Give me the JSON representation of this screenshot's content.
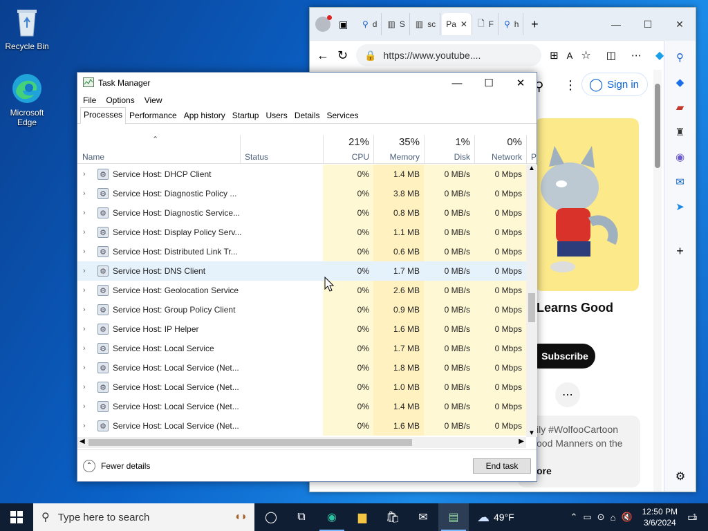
{
  "desktop": {
    "icons": [
      {
        "label": "Recycle Bin"
      },
      {
        "label": "Microsoft Edge"
      }
    ]
  },
  "edge": {
    "tabs": [
      "d",
      "S",
      "sc",
      "Pa",
      "F",
      "h"
    ],
    "address": "https://www.youtube....",
    "page": {
      "sign_in": "Sign in",
      "channel_title_fragment": "Learns Good",
      "subscribe": "Subscribe",
      "desc_line1": "ily #WolfooCartoon",
      "desc_line2": "ood Manners on the",
      "desc_line3": "ore"
    }
  },
  "taskmanager": {
    "title": "Task Manager",
    "menu": [
      "File",
      "Options",
      "View"
    ],
    "tabs": [
      "Processes",
      "Performance",
      "App history",
      "Startup",
      "Users",
      "Details",
      "Services"
    ],
    "active_tab": "Processes",
    "columns": {
      "name": "Name",
      "status": "Status",
      "cpu": {
        "label": "CPU",
        "pct": "21%"
      },
      "memory": {
        "label": "Memory",
        "pct": "35%"
      },
      "disk": {
        "label": "Disk",
        "pct": "1%"
      },
      "network": {
        "label": "Network",
        "pct": "0%"
      },
      "power": "P"
    },
    "rows": [
      {
        "name": "Service Host: DHCP Client",
        "cpu": "0%",
        "mem": "1.4 MB",
        "disk": "0 MB/s",
        "net": "0 Mbps"
      },
      {
        "name": "Service Host: Diagnostic Policy ...",
        "cpu": "0%",
        "mem": "3.8 MB",
        "disk": "0 MB/s",
        "net": "0 Mbps"
      },
      {
        "name": "Service Host: Diagnostic Service...",
        "cpu": "0%",
        "mem": "0.8 MB",
        "disk": "0 MB/s",
        "net": "0 Mbps"
      },
      {
        "name": "Service Host: Display Policy Serv...",
        "cpu": "0%",
        "mem": "1.1 MB",
        "disk": "0 MB/s",
        "net": "0 Mbps"
      },
      {
        "name": "Service Host: Distributed Link Tr...",
        "cpu": "0%",
        "mem": "0.6 MB",
        "disk": "0 MB/s",
        "net": "0 Mbps"
      },
      {
        "name": "Service Host: DNS Client",
        "cpu": "0%",
        "mem": "1.7 MB",
        "disk": "0 MB/s",
        "net": "0 Mbps",
        "selected": true
      },
      {
        "name": "Service Host: Geolocation Service",
        "cpu": "0%",
        "mem": "2.6 MB",
        "disk": "0 MB/s",
        "net": "0 Mbps"
      },
      {
        "name": "Service Host: Group Policy Client",
        "cpu": "0%",
        "mem": "0.9 MB",
        "disk": "0 MB/s",
        "net": "0 Mbps"
      },
      {
        "name": "Service Host: IP Helper",
        "cpu": "0%",
        "mem": "1.6 MB",
        "disk": "0 MB/s",
        "net": "0 Mbps"
      },
      {
        "name": "Service Host: Local Service",
        "cpu": "0%",
        "mem": "1.7 MB",
        "disk": "0 MB/s",
        "net": "0 Mbps"
      },
      {
        "name": "Service Host: Local Service (Net...",
        "cpu": "0%",
        "mem": "1.8 MB",
        "disk": "0 MB/s",
        "net": "0 Mbps"
      },
      {
        "name": "Service Host: Local Service (Net...",
        "cpu": "0%",
        "mem": "1.0 MB",
        "disk": "0 MB/s",
        "net": "0 Mbps"
      },
      {
        "name": "Service Host: Local Service (Net...",
        "cpu": "0%",
        "mem": "1.4 MB",
        "disk": "0 MB/s",
        "net": "0 Mbps"
      },
      {
        "name": "Service Host: Local Service (Net...",
        "cpu": "0%",
        "mem": "1.6 MB",
        "disk": "0 MB/s",
        "net": "0 Mbps"
      }
    ],
    "fewer_details": "Fewer details",
    "end_task": "End task"
  },
  "taskbar": {
    "search_placeholder": "Type here to search",
    "weather": "49°F",
    "time": "12:50 PM",
    "date": "3/6/2024",
    "notifications": "1"
  },
  "colors": {
    "cpu_col": "#fff8d4",
    "mem_col": "#fff1c0",
    "selected_row": "#e5f1fb",
    "taskbar": "#0f1e33"
  }
}
